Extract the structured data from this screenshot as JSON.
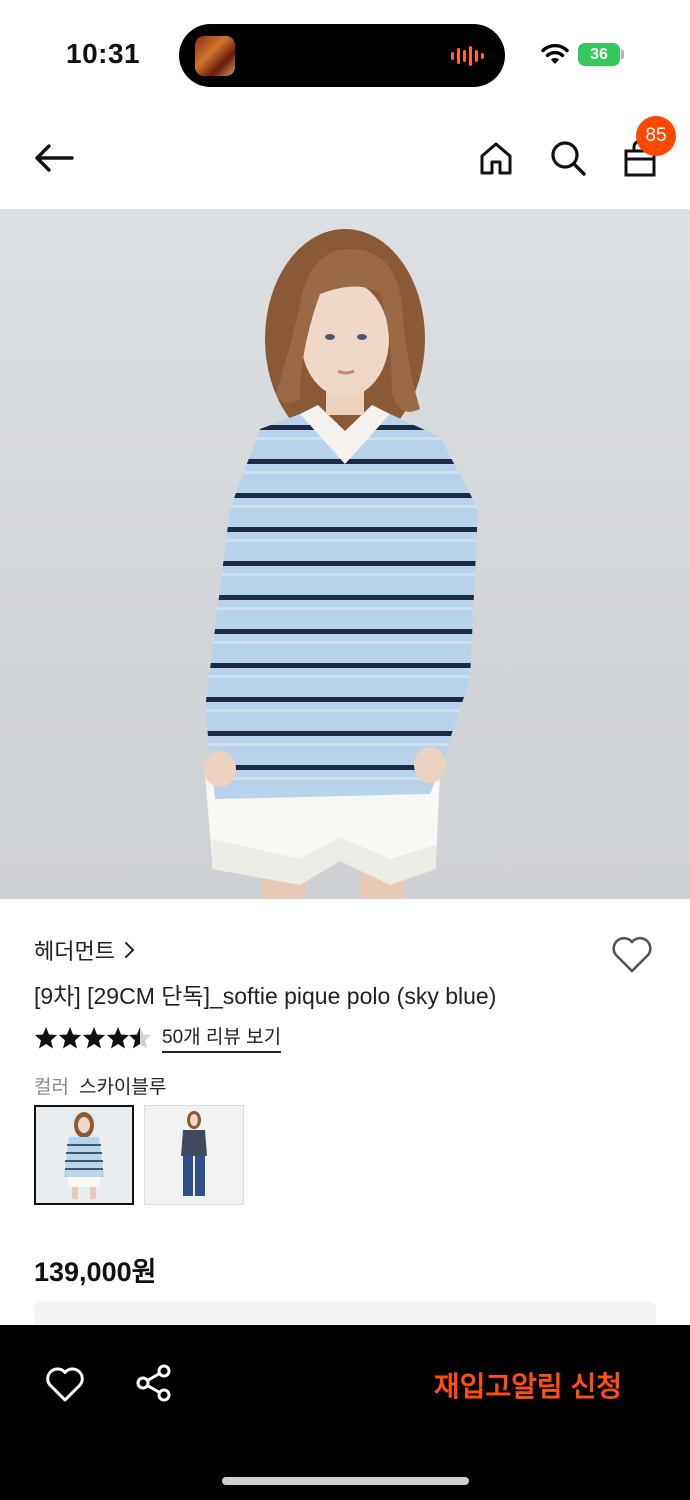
{
  "status_bar": {
    "time": "10:31",
    "battery_level": "36",
    "icons": [
      "now-playing-art",
      "audio-waveform-icon",
      "wifi-icon",
      "battery-icon"
    ],
    "battery_color": "#34c759"
  },
  "nav": {
    "icons": [
      "back-arrow-icon",
      "home-icon",
      "search-icon",
      "shopping-bag-icon"
    ],
    "cart_count": "85",
    "badge_color": "#ff4800"
  },
  "product": {
    "brand": "헤더먼트",
    "title": "[9차] [29CM 단독]_softie pique polo (sky blue)",
    "rating": 4.5,
    "review_link": "50개 리뷰 보기",
    "color_label": "컬러",
    "color_value": "스카이블루",
    "price": "139,000원",
    "wish_icon": "heart-outline-icon"
  },
  "bottom_bar": {
    "icons": [
      "heart-outline-icon",
      "share-icon"
    ],
    "restock_label": "재입고알림 신청",
    "accent_color": "#ff4f10"
  }
}
